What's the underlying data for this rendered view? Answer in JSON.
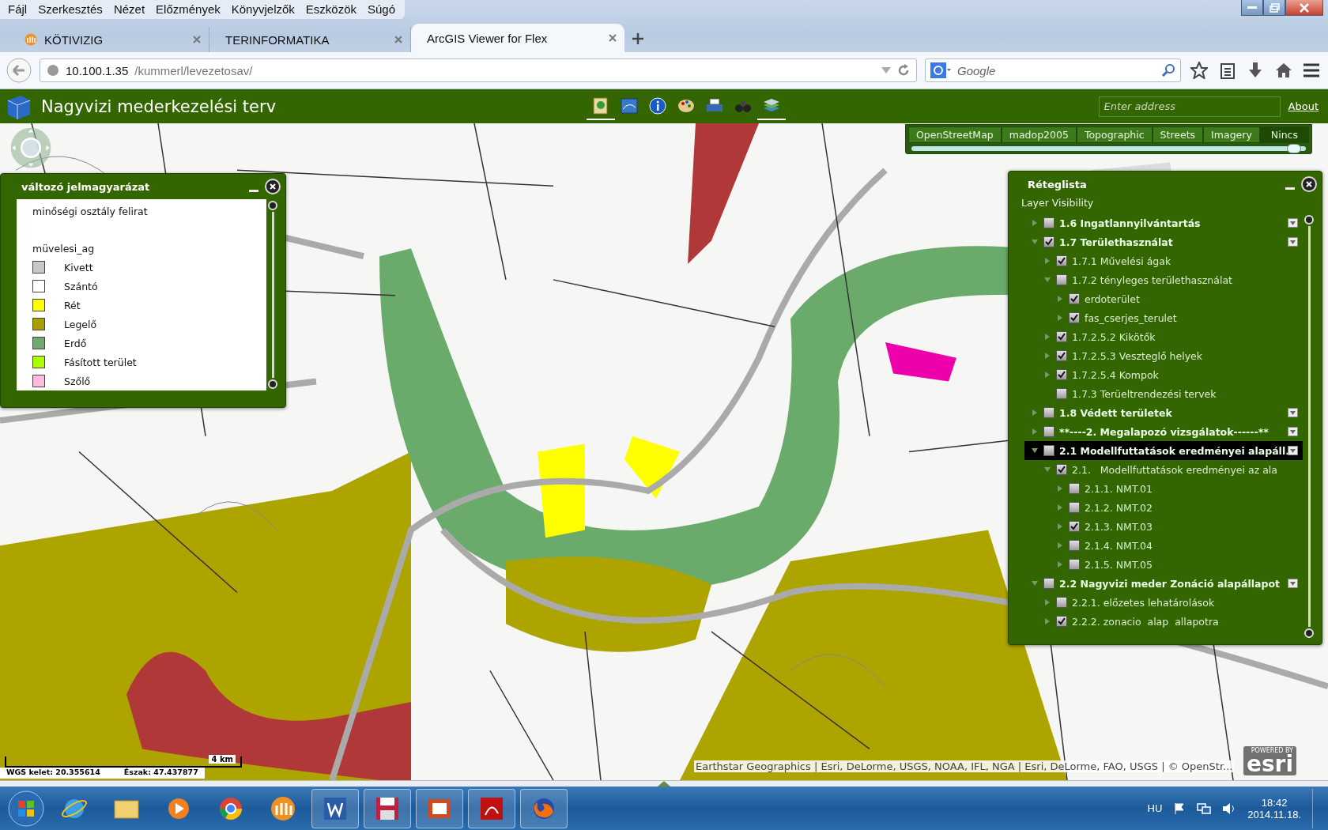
{
  "window": {
    "controls": [
      {
        "kind": "minimize"
      },
      {
        "kind": "maximize"
      },
      {
        "kind": "close"
      }
    ]
  },
  "menu": [
    "Fájl",
    "Szerkesztés",
    "Nézet",
    "Előzmények",
    "Könyvjelzők",
    "Eszközök",
    "Súgó"
  ],
  "tabs": [
    {
      "label": "KÖTIVIZIG",
      "selected": false,
      "kind": "people"
    },
    {
      "label": "TERINFORMATIKA",
      "selected": false,
      "kind": "none"
    },
    {
      "label": "ArcGIS Viewer for Flex",
      "selected": true,
      "kind": "none"
    }
  ],
  "address_bar": {
    "host": "10.100.1.35",
    "path": "/kummerl/levezetosav/"
  },
  "search": {
    "placeholder": "Google"
  },
  "app": {
    "title": "Nagyvizi mederkezelési terv",
    "toolbar": [
      {
        "kind": "legend",
        "open": true
      },
      {
        "kind": "map",
        "open": false
      },
      {
        "kind": "info",
        "open": false
      },
      {
        "kind": "palette",
        "open": false
      },
      {
        "kind": "printer",
        "open": false
      },
      {
        "kind": "binoculars",
        "open": false
      },
      {
        "kind": "layers",
        "open": true
      }
    ],
    "address_search": {
      "placeholder": "Enter address"
    },
    "about_link": "About"
  },
  "basemaps": {
    "items": [
      {
        "label": "OpenStreetMap",
        "selected": false
      },
      {
        "label": "madop2005",
        "selected": false
      },
      {
        "label": "Topographic",
        "selected": false
      },
      {
        "label": "Streets",
        "selected": false
      },
      {
        "label": "Imagery",
        "selected": false
      },
      {
        "label": "Nincs",
        "selected": true
      }
    ],
    "opacity": {
      "level": 0.97
    }
  },
  "legend_panel": {
    "title": "változó jelmagyarázat",
    "caption": "minőségi osztály felirat",
    "group": "müvelesi_ag",
    "items": [
      {
        "label": "Kivett",
        "color": "#c8c8c8"
      },
      {
        "label": "Szántó",
        "color": "#ffffff"
      },
      {
        "label": "Rét",
        "color": "#ffff00"
      },
      {
        "label": "Legelő",
        "color": "#a8a000"
      },
      {
        "label": "Erdő",
        "color": "#70a870"
      },
      {
        "label": "Fásított terület",
        "color": "#aaff00"
      },
      {
        "label": "Szőlő",
        "color": "#ffbbdd"
      }
    ]
  },
  "layer_panel": {
    "title": "Réteglista",
    "subtitle": "Layer Visibility",
    "layers": [
      {
        "label": "1.6 Ingatlannyilvántartás",
        "checked": false,
        "expanded": false,
        "selected": false
      },
      {
        "label": "1.7 Területhasználat",
        "checked": true,
        "expanded": true,
        "selected": false,
        "children": [
          {
            "label": "1.7.1 Művelési ágak",
            "checked": true,
            "expanded": false,
            "selected": false
          },
          {
            "label": "1.7.2 tényleges területhasználat",
            "checked": false,
            "expanded": true,
            "selected": false,
            "children": [
              {
                "label": "erdoterület",
                "checked": true,
                "expanded": false,
                "selected": false
              },
              {
                "label": "fas_cserjes_terulet",
                "checked": true,
                "expanded": false,
                "selected": false
              }
            ]
          },
          {
            "label": "1.7.2.5.2 Kikötők",
            "checked": true,
            "expanded": false,
            "selected": false
          },
          {
            "label": "1.7.2.5.3 Veszteglő helyek",
            "checked": true,
            "expanded": false,
            "selected": false
          },
          {
            "label": "1.7.2.5.4 Kompok",
            "checked": true,
            "expanded": false,
            "selected": false
          },
          {
            "label": "1.7.3 Terüeltrendezési tervek",
            "checked": false,
            "selected": false
          }
        ]
      },
      {
        "label": "1.8 Védett területek",
        "checked": false,
        "expanded": false,
        "selected": false
      },
      {
        "label": "**----2. Megalapozó vizsgálatok------**",
        "checked": false,
        "expanded": false,
        "selected": false
      },
      {
        "label": "2.1 Modellfuttatások eredményei alapáll.",
        "checked": false,
        "expanded": true,
        "selected": true,
        "children": [
          {
            "label": "2.1.   Modellfuttatások eredményei az ala",
            "checked": true,
            "expanded": true,
            "selected": false,
            "children": [
              {
                "label": "2.1.1. NMT.01",
                "checked": false,
                "expanded": false,
                "selected": false
              },
              {
                "label": "2.1.2. NMT.02",
                "checked": false,
                "expanded": false,
                "selected": false
              },
              {
                "label": "2.1.3. NMT.03",
                "checked": true,
                "expanded": false,
                "selected": false
              },
              {
                "label": "2.1.4. NMT.04",
                "checked": false,
                "expanded": false,
                "selected": false
              },
              {
                "label": "2.1.5. NMT.05",
                "checked": false,
                "expanded": false,
                "selected": false
              }
            ]
          }
        ]
      },
      {
        "label": "2.2 Nagyvizi meder Zonáció alapállapot",
        "checked": false,
        "expanded": true,
        "selected": false,
        "children": [
          {
            "label": "2.2.1. előzetes lehatárolások",
            "checked": false,
            "expanded": false,
            "selected": false
          },
          {
            "label": "2.2.2. zonacio  alap  allapotra",
            "checked": true,
            "expanded": false,
            "selected": false
          }
        ]
      }
    ]
  },
  "map_footer": {
    "scale": "4 km",
    "coord_east": "WGS kelet: 20.355614",
    "coord_north": "Észak: 47.437877",
    "attribution": "Earthstar Geographics | Esri, DeLorme, USGS, NOAA, IFL, NGA | Esri, DeLorme, FAO, USGS | © OpenStr...",
    "logo_small": "POWERED BY",
    "logo": "esri"
  },
  "taskbar": {
    "apps": [
      {
        "kind": "ie",
        "open": false
      },
      {
        "kind": "folder",
        "open": false
      },
      {
        "kind": "media",
        "open": false
      },
      {
        "kind": "chrome",
        "open": false
      },
      {
        "kind": "people",
        "open": false
      },
      {
        "kind": "word",
        "open": true
      },
      {
        "kind": "floppy",
        "open": true
      },
      {
        "kind": "slides",
        "open": true
      },
      {
        "kind": "pdf",
        "open": true
      },
      {
        "kind": "firefox",
        "open": true
      }
    ],
    "language": "HU",
    "time": "18:42",
    "date": "2014.11.18."
  }
}
